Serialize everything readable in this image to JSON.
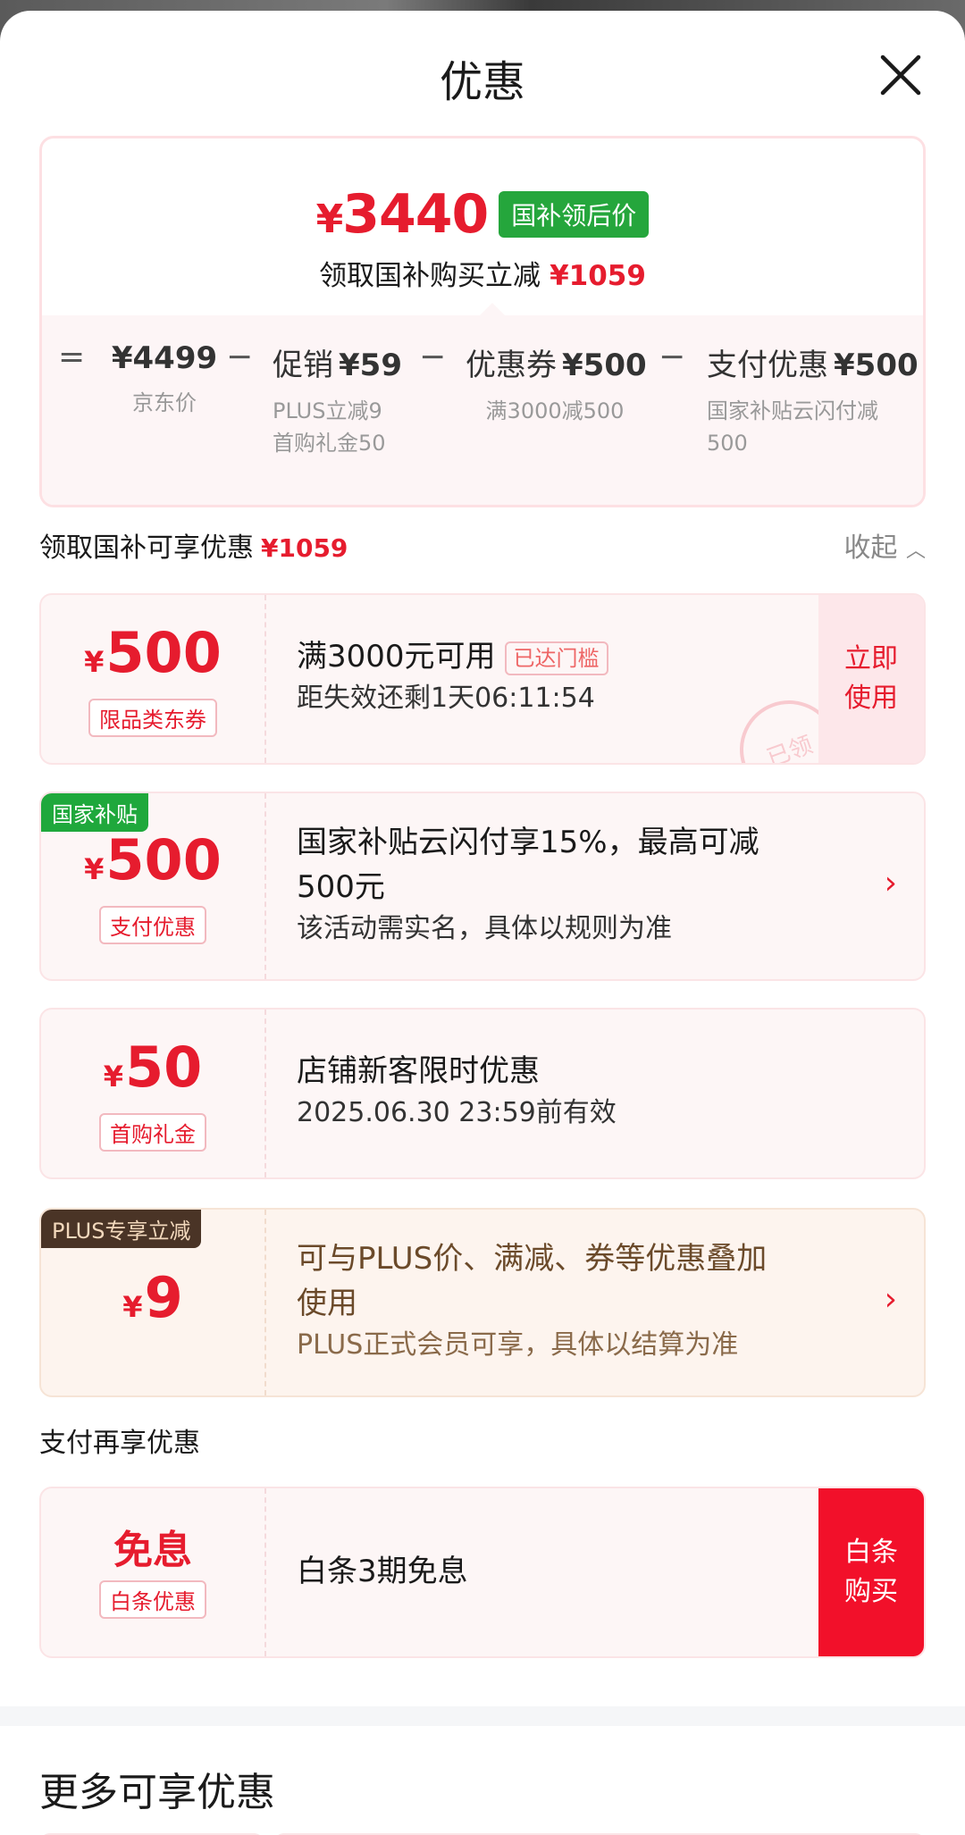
{
  "header": {
    "title": "优惠"
  },
  "summary": {
    "final_yen": "¥",
    "final_price": "3440",
    "final_badge": "国补领后价",
    "save_text": "领取国补购买立减",
    "save_amount": "¥1059",
    "ops": [
      "=",
      "−",
      "−",
      "−"
    ],
    "items": [
      {
        "label": "",
        "value": "¥4499",
        "subs": [
          "京东价"
        ]
      },
      {
        "label": "促销",
        "value": "¥59",
        "subs": [
          "PLUS立减9",
          "首购礼金50"
        ]
      },
      {
        "label": "优惠券",
        "value": "¥500",
        "subs": [
          "满3000减500"
        ]
      },
      {
        "label": "支付优惠",
        "value": "¥500",
        "subs": [
          "国家补贴云闪付减",
          "500"
        ]
      }
    ]
  },
  "section1": {
    "title": "领取国补可享优惠",
    "amount": "¥1059",
    "collapse": "收起"
  },
  "coupons": [
    {
      "yen": "¥",
      "amount": "500",
      "tag": "限品类东券",
      "line1": "满3000元可用",
      "badge": "已达门槛",
      "line2": "距失效还剩1天06:11:54",
      "action": "立即使用",
      "action_l1": "立即",
      "action_l2": "使用",
      "stamp": "已领"
    },
    {
      "corner": "国家补贴",
      "yen": "¥",
      "amount": "500",
      "tag": "支付优惠",
      "line1a": "国家补贴云闪付享15%，最高可减",
      "line1b": "500元",
      "line2": "该活动需实名，具体以规则为准"
    },
    {
      "yen": "¥",
      "amount": "50",
      "tag": "首购礼金",
      "line1": "店铺新客限时优惠",
      "line2": "2025.06.30 23:59前有效"
    },
    {
      "corner": "PLUS专享立减",
      "yen": "¥",
      "amount": "9",
      "line1a": "可与PLUS价、满减、券等优惠叠加",
      "line1b": "使用",
      "line2": "PLUS正式会员可享，具体以结算为准"
    }
  ],
  "section2": {
    "title": "支付再享优惠"
  },
  "baitiao": {
    "amount": "免息",
    "tag": "白条优惠",
    "line1": "白条3期免息",
    "action_l1": "白条",
    "action_l2": "购买"
  },
  "more": {
    "title": "更多可享优惠"
  },
  "icons": {
    "close": "close-icon",
    "chevron_up": "chevron-up-icon",
    "chevron_right": "chevron-right-icon"
  },
  "colors": {
    "accent": "#e61c2e",
    "green": "#25a63c",
    "plus_dark": "#4a3426"
  }
}
